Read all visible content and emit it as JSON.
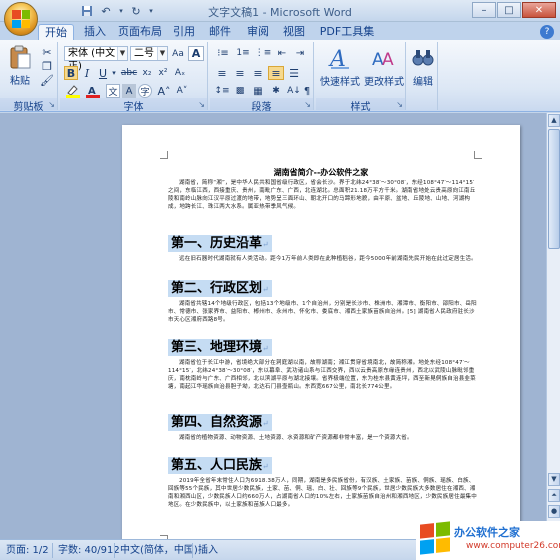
{
  "window": {
    "title": "文字文稿1 - Microsoft Word"
  },
  "tabs": [
    "开始",
    "插入",
    "页面布局",
    "引用",
    "邮件",
    "审阅",
    "视图",
    "PDF工具集"
  ],
  "ribbon": {
    "clipboard": {
      "label": "剪贴板",
      "paste": "粘贴"
    },
    "font": {
      "label": "字体",
      "font_name": "宋体 (中文正)",
      "font_size": "二号"
    },
    "paragraph": {
      "label": "段落"
    },
    "styles": {
      "label": "样式",
      "quick_styles": "快速样式",
      "change_styles": "更改样式"
    },
    "editing": {
      "label": "编辑"
    }
  },
  "document": {
    "title": "湖南省简介--办公软件之家",
    "intro": "湖南省，简称“湘”，是中华人民共和国省级行政区，省会长沙。界于北纬24°38′～30°08′，东经108°47′～114°15′之间，东临江西，西接重庆、贵州，南毗广东、广西，北连湖北。总面积21.18万平方千米。湖南省地处云贵高原向江南丘陵和南岭山脉向江汉平原过渡的地带，地势呈三面环山、朝北开口的马蹄形地貌，由平原、盆地、丘陵地、山地、河湖构成，地跨长江、珠江两大水系。属亚热带季风气候。",
    "sections": [
      {
        "heading": "第一、历史沿革",
        "text": "远在旧石器时代湖南就有人类活动。距今1万年前人类即在此种植稻谷，距今5000年前湖南先民开始在此过定居生活。"
      },
      {
        "heading": "第二、行政区划",
        "text": "湖南省共辖14个地级行政区，包括13个地级市、1个自治州，分别是长沙市、株洲市、湘潭市、衡阳市、邵阳市、岳阳市、常德市、张家界市、益阳市、郴州市、永州市、怀化市、娄底市、湘西土家族苗族自治州。[5] 湖南省人民政府驻长沙市天心区湘府西路8号。"
      },
      {
        "heading": "第三、地理环境",
        "text": "湖南省位于长江中游，省境绝大部分在洞庭湖以南，故称湖南；湘江贯穿省境南北，故简称湘。地处东经108°47′～114°15′，北纬24°38′～30°08′，东以幕阜、武功诸山系与江西交界，西以云贵高原东缘连贵州，西北以武陵山脉毗邻重庆，南枕南岭与广东、广西相邻，北以滨湖平原与湖北接壤。省界极端位置，东为桂东县黄连坪，西至新晃侗族自治县韭菜塘，南起江华瑶族自治县胆子坳，北达石门县壶瓶山。东西宽667公里，南北长774公里。"
      },
      {
        "heading": "第四、自然资源",
        "text": "湖南省的植物资源、动物资源、土地资源、水资源和矿产资源都非常丰富，是一个资源大省。"
      },
      {
        "heading": "第五、人口民族",
        "text": "2019年全省年末常住人口为6918.38万人，同期，湖南是多民族省份，有汉族、土家族、苗族、侗族、瑶族、白族、回族等55个民族，其中世居少数民族，土家、苗、侗、瑶、白、壮、回族等9个民族，世居少数民族大多数居住在湘西、湘南和湘西山区，少数民族人口约660万人，占湖南省人口的10%左右，土家族苗族自治州和湘西地区，少数民族居住最集中地区。在少数民族中，以土家族和苗族人口最多。"
      }
    ]
  },
  "status": {
    "page": "页面: 1/2",
    "words": "字数: 40/912",
    "language": "中文(简体，中国)",
    "mode": "插入"
  },
  "watermark": {
    "line1": "办公软件之家",
    "line2": "www.computer26.com"
  },
  "colors": {
    "heading_highlight": "#c5dcf3",
    "ribbon": "#dce7f5",
    "frame": "#c4d5ea"
  }
}
